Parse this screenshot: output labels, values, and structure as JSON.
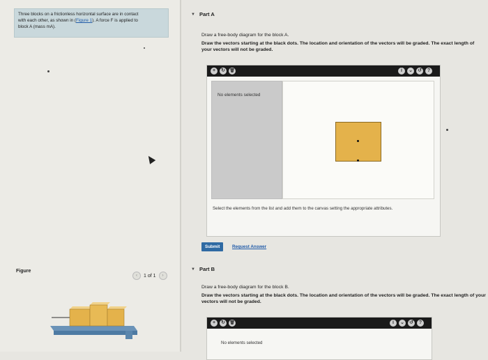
{
  "problem": {
    "line1": "Three blocks on a frictionless horizontal surface are in contact",
    "line2_pre": "with each other, as shown in (",
    "figure_link": "Figure 1",
    "line2_post": "). A force F is applied to",
    "line3": "block A (mass mA)."
  },
  "figure": {
    "label": "Figure",
    "pager": "1 of 1",
    "prev_icon": "‹",
    "next_icon": "›"
  },
  "partA": {
    "header": "Part A",
    "instruction": "Draw a free-body diagram for the block A.",
    "bold_instruction": "Draw the vectors starting at the black dots. The location and orientation of the vectors will be graded. The exact length of your vectors will not be graded.",
    "no_elements": "No elements selected",
    "hint": "Select the elements from the list and add them to the canvas setting the appropriate attributes.",
    "submit": "Submit",
    "request_answer": "Request Answer"
  },
  "partB": {
    "header": "Part B",
    "instruction": "Draw a free-body diagram for the block B.",
    "bold_instruction": "Draw the vectors starting at the black dots. The location and orientation of the vectors will be graded. The exact length of your vectors will not be graded.",
    "no_elements": "No elements selected"
  },
  "toolbar": {
    "left_icons": [
      "+",
      "↻",
      "🗑"
    ],
    "right_icons": [
      "i",
      "⌄",
      "↺",
      "?"
    ]
  },
  "colors": {
    "toolbar": "#1a1a1a",
    "block": "#e4b24b",
    "submit": "#2f6aa3",
    "link": "#1f5aa8",
    "problem_bg": "#c9d8dc"
  }
}
